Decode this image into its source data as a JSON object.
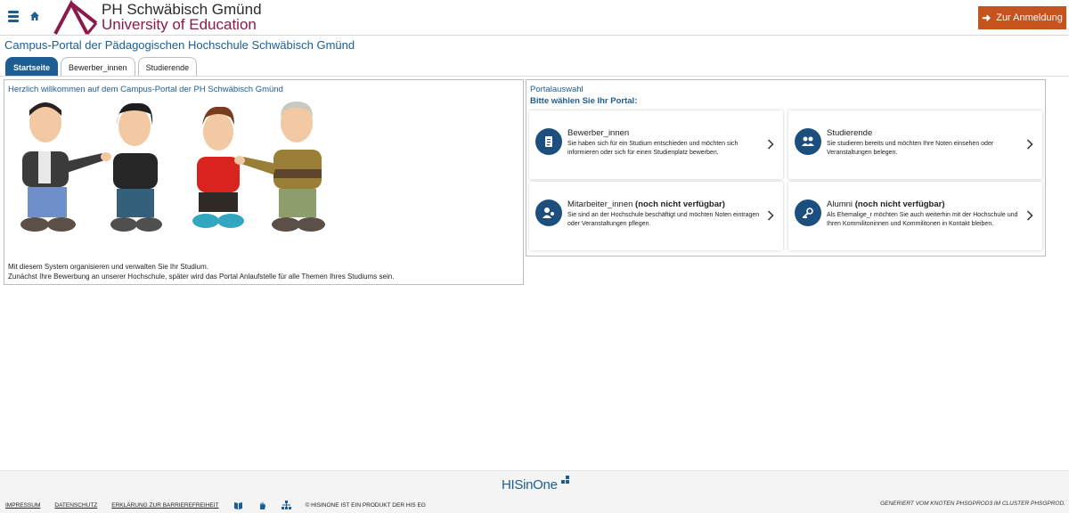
{
  "header": {
    "logo_line1": "PH Schwäbisch Gmünd",
    "logo_line2": "University of Education",
    "login_label": "Zur Anmeldung"
  },
  "page_title": "Campus-Portal der Pädagogischen Hochschule Schwäbisch Gmünd",
  "tabs": [
    {
      "label": "Startseite",
      "active": true
    },
    {
      "label": "Bewerber_innen",
      "active": false
    },
    {
      "label": "Studierende",
      "active": false
    }
  ],
  "welcome": {
    "title": "Herzlich willkommen auf dem Campus-Portal der PH Schwäbisch Gmünd",
    "text_line1": "Mit diesem System organisieren und verwalten Sie Ihr Studium.",
    "text_line2": "Zunächst Ihre Bewerbung an unserer Hochschule, später wird das Portal Anlaufstelle für alle Themen Ihres Studiums sein."
  },
  "portal": {
    "title": "Portalauswahl",
    "subtitle": "Bitte wählen Sie Ihr Portal:",
    "cards": [
      {
        "title": "Bewerber_innen",
        "suffix": "",
        "icon": "document-icon",
        "desc": "Sie haben sich für ein Studium entschieden und möchten sich informieren oder sich für einen Studienplatz bewerben."
      },
      {
        "title": "Studierende",
        "suffix": "",
        "icon": "students-icon",
        "desc": "Sie studieren bereits und möchten Ihre Noten einsehen oder Veranstaltungen belegen."
      },
      {
        "title": "Mitarbeiter_innen",
        "suffix": "(noch nicht verfügbar)",
        "icon": "staff-icon",
        "desc": "Sie sind an der Hochschule beschäftigt und möchten Noten eintragen oder Veranstaltungen pflegen."
      },
      {
        "title": "Alumni",
        "suffix": "(noch nicht verfügbar)",
        "icon": "alumni-icon",
        "desc": "Als Ehemalige_r möchten Sie auch weiterhin mit der Hochschule und Ihren Kommilitoninnen und Kommilitonen in Kontakt bleiben."
      }
    ]
  },
  "footer": {
    "his_logo": "HISinOne",
    "impressum": "IMPRESSUM",
    "datenschutz": "DATENSCHUTZ",
    "barrierefreiheit": "ERKLÄRUNG ZUR BARRIEREFREIHEIT",
    "copyright": "© HISINONE IST EIN PRODUKT DER HIS EG",
    "generated": "GENERIERT VOM KNOTEN PHSGPROD3 IM CLUSTER PHSGPROD."
  },
  "colors": {
    "primary": "#1d5d91",
    "accent": "#c4531e",
    "brand": "#8b1a4a"
  }
}
